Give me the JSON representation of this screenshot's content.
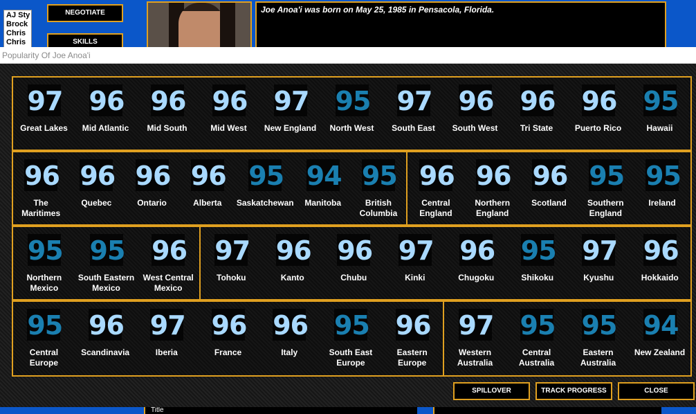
{
  "background": {
    "roster": [
      "AJ Sty",
      "Brock",
      "Chris",
      "Chris"
    ],
    "buttons": {
      "negotiate": "NEGOTIATE",
      "skills": "SKILLS"
    },
    "bio": "Joe Anoa'i was born on May 25, 1985 in Pensacola, Florida.",
    "bottom_text": "Title"
  },
  "window": {
    "title": "Popularity Of Joe Anoa'i"
  },
  "rows": [
    {
      "groups": [
        {
          "regions": [
            {
              "name": "Great Lakes",
              "value": "97"
            },
            {
              "name": "Mid Atlantic",
              "value": "96"
            },
            {
              "name": "Mid South",
              "value": "96"
            },
            {
              "name": "Mid West",
              "value": "96"
            },
            {
              "name": "New England",
              "value": "97"
            },
            {
              "name": "North West",
              "value": "95"
            },
            {
              "name": "South East",
              "value": "97"
            },
            {
              "name": "South West",
              "value": "96"
            },
            {
              "name": "Tri State",
              "value": "96"
            },
            {
              "name": "Puerto Rico",
              "value": "96"
            },
            {
              "name": "Hawaii",
              "value": "95"
            }
          ]
        }
      ]
    },
    {
      "groups": [
        {
          "regions": [
            {
              "name": "The Maritimes",
              "value": "96"
            },
            {
              "name": "Quebec",
              "value": "96"
            },
            {
              "name": "Ontario",
              "value": "96"
            },
            {
              "name": "Alberta",
              "value": "96"
            },
            {
              "name": "Saskatchewan",
              "value": "95"
            },
            {
              "name": "Manitoba",
              "value": "94"
            },
            {
              "name": "British\nColumbia",
              "value": "95"
            }
          ]
        },
        {
          "regions": [
            {
              "name": "Central\nEngland",
              "value": "96"
            },
            {
              "name": "Northern\nEngland",
              "value": "96"
            },
            {
              "name": "Scotland",
              "value": "96"
            },
            {
              "name": "Southern\nEngland",
              "value": "95"
            },
            {
              "name": "Ireland",
              "value": "95"
            }
          ]
        }
      ]
    },
    {
      "groups": [
        {
          "regions": [
            {
              "name": "Northern\nMexico",
              "value": "95"
            },
            {
              "name": "South Eastern\nMexico",
              "value": "95"
            },
            {
              "name": "West Central\nMexico",
              "value": "96"
            }
          ]
        },
        {
          "regions": [
            {
              "name": "Tohoku",
              "value": "97"
            },
            {
              "name": "Kanto",
              "value": "96"
            },
            {
              "name": "Chubu",
              "value": "96"
            },
            {
              "name": "Kinki",
              "value": "97"
            },
            {
              "name": "Chugoku",
              "value": "96"
            },
            {
              "name": "Shikoku",
              "value": "95"
            },
            {
              "name": "Kyushu",
              "value": "97"
            },
            {
              "name": "Hokkaido",
              "value": "96"
            }
          ]
        }
      ]
    },
    {
      "groups": [
        {
          "regions": [
            {
              "name": "Central\nEurope",
              "value": "95"
            },
            {
              "name": "Scandinavia",
              "value": "96"
            },
            {
              "name": "Iberia",
              "value": "97"
            },
            {
              "name": "France",
              "value": "96"
            },
            {
              "name": "Italy",
              "value": "96"
            },
            {
              "name": "South East\nEurope",
              "value": "95"
            },
            {
              "name": "Eastern\nEurope",
              "value": "96"
            }
          ]
        },
        {
          "regions": [
            {
              "name": "Western\nAustralia",
              "value": "97"
            },
            {
              "name": "Central\nAustralia",
              "value": "95"
            },
            {
              "name": "Eastern\nAustralia",
              "value": "95"
            },
            {
              "name": "New Zealand",
              "value": "94"
            }
          ]
        }
      ]
    }
  ],
  "footer": {
    "spillover": "SPILLOVER",
    "track_progress": "TRACK PROGRESS",
    "close": "CLOSE"
  },
  "colors": {
    "accent": "#e0a020",
    "value_high": "#a9d9ff",
    "value_low": "#1a7fb0",
    "app_blue": "#0b57c9"
  }
}
